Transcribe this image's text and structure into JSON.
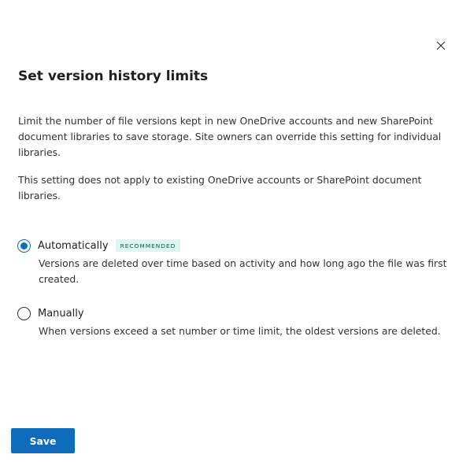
{
  "dialog": {
    "title": "Set version history limits",
    "description_1": "Limit the number of file versions kept in new OneDrive accounts and new SharePoint document libraries to save storage. Site owners can override this setting for individual libraries.",
    "description_2": "This setting does not apply to existing OneDrive accounts or SharePoint document libraries.",
    "close_icon": "close-icon"
  },
  "options": {
    "automatic": {
      "label": "Automatically",
      "badge": "RECOMMENDED",
      "description": "Versions are deleted over time based on activity and how long ago the file was first created.",
      "selected": true
    },
    "manual": {
      "label": "Manually",
      "description": "When versions exceed a set number or time limit, the oldest versions are deleted.",
      "selected": false
    }
  },
  "footer": {
    "save_label": "Save"
  },
  "colors": {
    "accent": "#0f6cbd",
    "badge_bg": "#dff6f0",
    "text": "#323130"
  }
}
